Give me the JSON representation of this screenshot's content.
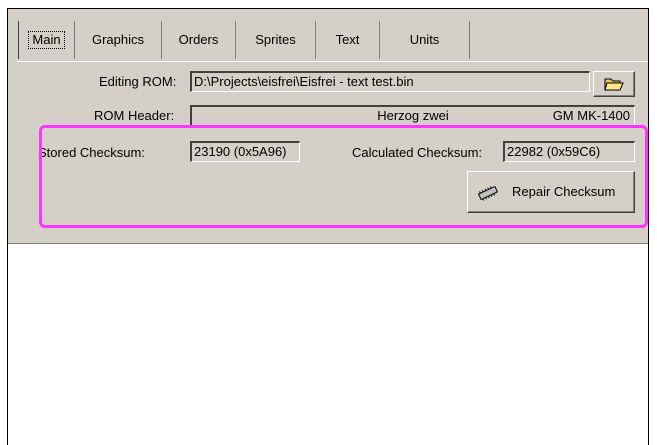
{
  "tabs": [
    {
      "label": "Main",
      "active": true
    },
    {
      "label": "Graphics",
      "active": false
    },
    {
      "label": "Orders",
      "active": false
    },
    {
      "label": "Sprites",
      "active": false
    },
    {
      "label": "Text",
      "active": false
    },
    {
      "label": "Units",
      "active": false
    }
  ],
  "editing_rom": {
    "label": "Editing ROM:",
    "value": "D:\\Projects\\eisfrei\\Eisfrei - text test.bin",
    "browse_icon": "folder-icon"
  },
  "rom_header": {
    "label": "ROM Header:",
    "title": "Herzog zwei",
    "code": "GM MK-1400"
  },
  "checksum": {
    "stored_label": "Stored Checksum:",
    "stored_value": "23190 (0x5A96)",
    "calculated_label": "Calculated Checksum:",
    "calculated_value": "22982 (0x59C6)",
    "repair_label": "Repair Checksum",
    "repair_icon": "chip-icon"
  },
  "colors": {
    "window_bg": "#d4d0c8",
    "highlight": "#ff33ff"
  }
}
